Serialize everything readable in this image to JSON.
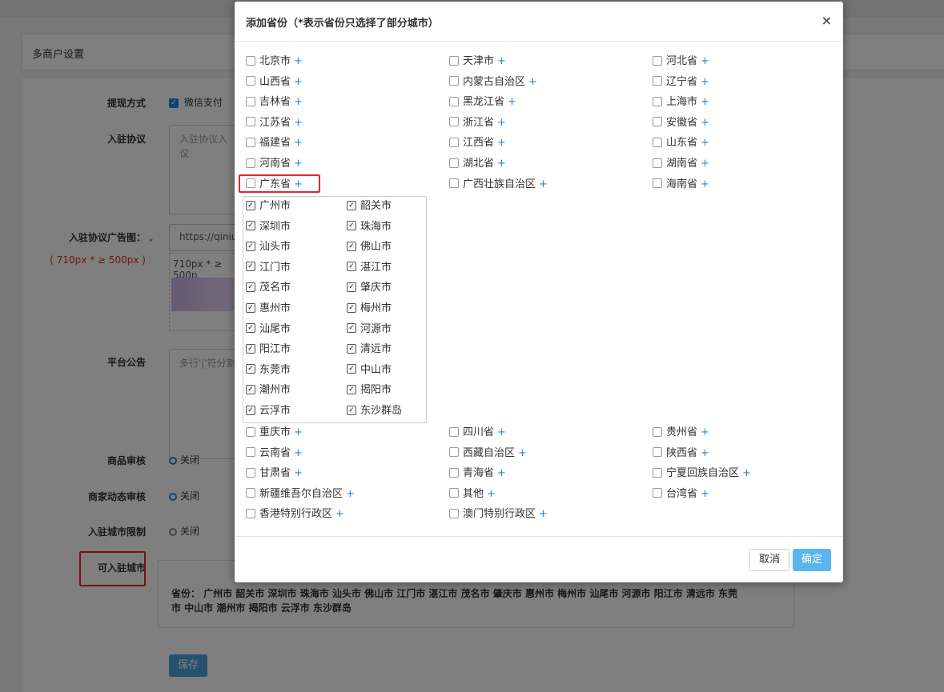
{
  "page": {
    "title": "多商户设置",
    "withdraw": {
      "label": "提现方式",
      "option": "微信支付"
    },
    "agreement": {
      "label": "入驻协议",
      "value_line1": "入驻协议入",
      "value_line2": "议"
    },
    "ad_image": {
      "label": "入驻协议广告图：",
      "hint": "( 710px * ≥ 500px )",
      "url": "https://qiniu.",
      "size_text": "710px * ≥ 500p"
    },
    "notice": {
      "label": "平台公告",
      "placeholder": "多行'|'符分割"
    },
    "goods_review": {
      "label": "商品审核",
      "option": "关闭"
    },
    "dynamic_review": {
      "label": "商家动态审核",
      "option": "关闭"
    },
    "city_limit": {
      "label": "入驻城市限制",
      "option": "关闭"
    },
    "allowed_cities": {
      "label": "可入驻城市",
      "text_line1": "省份： 广州市 韶关市 深圳市 珠海市 汕头市 佛山市 江门市 湛江市 茂名市 肇庆市 惠州市 梅州市 汕尾市 河源市 阳江市 清远市 东莞",
      "text_line2": "市 中山市 潮州市 揭阳市 云浮市 东沙群岛"
    },
    "save_label": "保存"
  },
  "modal": {
    "title": "添加省份（*表示省份只选择了部分城市）",
    "close_label": "×",
    "plus_label": "+",
    "provinces_top": [
      [
        "北京市",
        "天津市",
        "河北省"
      ],
      [
        "山西省",
        "内蒙古自治区",
        "辽宁省"
      ],
      [
        "吉林省",
        "黑龙江省",
        "上海市"
      ],
      [
        "江苏省",
        "浙江省",
        "安徽省"
      ],
      [
        "福建省",
        "江西省",
        "山东省"
      ],
      [
        "河南省",
        "湖北省",
        "湖南省"
      ],
      [
        "广东省",
        "广西壮族自治区",
        "海南省"
      ]
    ],
    "cities": [
      [
        "广州市",
        "韶关市"
      ],
      [
        "深圳市",
        "珠海市"
      ],
      [
        "汕头市",
        "佛山市"
      ],
      [
        "江门市",
        "湛江市"
      ],
      [
        "茂名市",
        "肇庆市"
      ],
      [
        "惠州市",
        "梅州市"
      ],
      [
        "汕尾市",
        "河源市"
      ],
      [
        "阳江市",
        "清远市"
      ],
      [
        "东莞市",
        "中山市"
      ],
      [
        "潮州市",
        "揭阳市"
      ],
      [
        "云浮市",
        "东沙群岛"
      ]
    ],
    "provinces_bottom": [
      [
        "重庆市",
        "四川省",
        "贵州省"
      ],
      [
        "云南省",
        "西藏自治区",
        "陕西省"
      ],
      [
        "甘肃省",
        "青海省",
        "宁夏回族自治区"
      ],
      [
        "新疆维吾尔自治区",
        "其他",
        "台湾省"
      ],
      [
        "香港特别行政区",
        "澳门特别行政区",
        ""
      ]
    ],
    "cancel_label": "取消",
    "ok_label": "确定"
  },
  "colors": {
    "accent": "#1e88e5",
    "highlight": "#e6262c",
    "ok_button": "#5ab4f0"
  }
}
